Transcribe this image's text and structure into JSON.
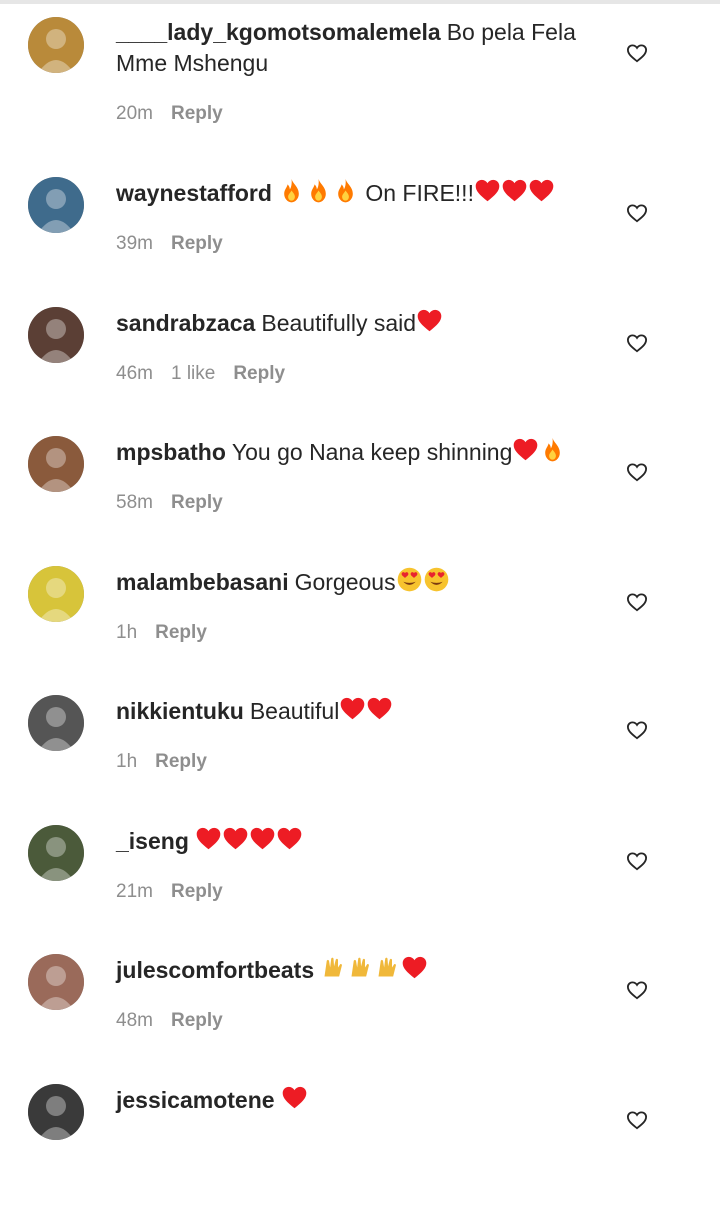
{
  "comments": [
    {
      "username": "____lady_kgomotsomalemela",
      "text": "Bo pela Fela Mme Mshengu",
      "time": "20m",
      "likes": "",
      "reply": "Reply",
      "emoji": [],
      "avatar_color": "#b98a3a"
    },
    {
      "username": "waynestafford",
      "text": "On FIRE!!!",
      "time": "39m",
      "likes": "",
      "reply": "Reply",
      "emoji_before": [
        "fire",
        "fire",
        "fire"
      ],
      "emoji": [
        "heart",
        "heart",
        "heart"
      ],
      "avatar_color": "#3f6b8c"
    },
    {
      "username": "sandrabzaca",
      "text": "Beautifully said",
      "time": "46m",
      "likes": "1 like",
      "reply": "Reply",
      "emoji": [
        "heart"
      ],
      "avatar_color": "#5b3f35"
    },
    {
      "username": "mpsbatho",
      "text": "You go Nana keep shinning",
      "time": "58m",
      "likes": "",
      "reply": "Reply",
      "emoji": [
        "heart",
        "fire"
      ],
      "avatar_color": "#8a5a3c"
    },
    {
      "username": "malambebasani",
      "text": "Gorgeous",
      "time": "1h",
      "likes": "",
      "reply": "Reply",
      "emoji": [
        "heart-eyes",
        "heart-eyes"
      ],
      "avatar_color": "#d7c43a"
    },
    {
      "username": "nikkientuku",
      "text": "Beautiful",
      "time": "1h",
      "likes": "",
      "reply": "Reply",
      "emoji": [
        "heart",
        "heart"
      ],
      "avatar_color": "#555555"
    },
    {
      "username": "_iseng",
      "text": "",
      "time": "21m",
      "likes": "",
      "reply": "Reply",
      "emoji": [
        "heart",
        "heart",
        "heart",
        "heart"
      ],
      "avatar_color": "#4b5a3a"
    },
    {
      "username": "julescomfortbeats",
      "text": "",
      "time": "48m",
      "likes": "",
      "reply": "Reply",
      "emoji": [
        "clap",
        "clap",
        "clap",
        "heart"
      ],
      "avatar_color": "#9a6a5a"
    },
    {
      "username": "jessicamotene",
      "text": "",
      "time": "",
      "likes": "",
      "reply": "",
      "emoji": [
        "heart"
      ],
      "avatar_color": "#3a3a3a"
    }
  ],
  "colors": {
    "text": "#262626",
    "meta": "#8e8e8e",
    "heart": "#ed1c24",
    "fire": "#ff7a00"
  }
}
